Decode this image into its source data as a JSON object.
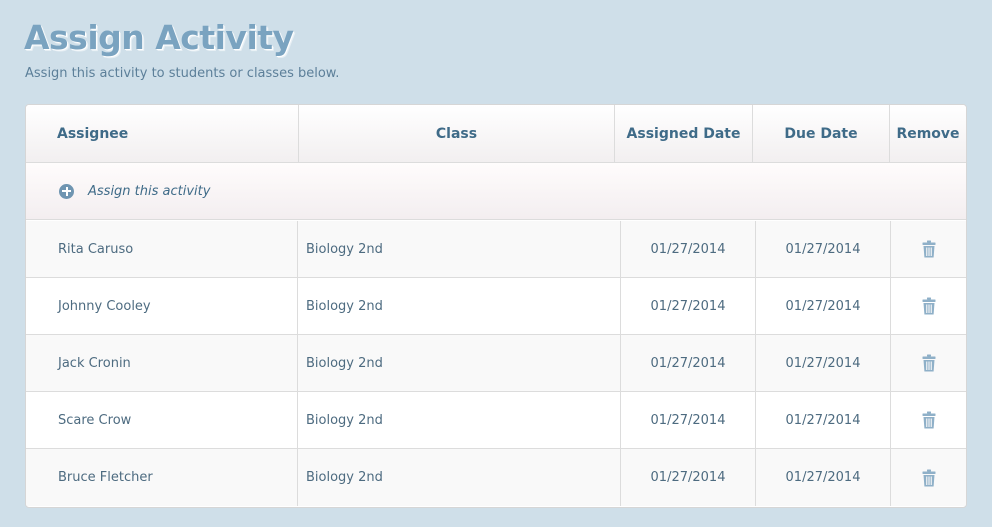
{
  "page": {
    "title": "Assign Activity",
    "subtitle": "Assign this activity to students or classes below."
  },
  "table": {
    "headers": {
      "assignee": "Assignee",
      "class": "Class",
      "assigned_date": "Assigned Date",
      "due_date": "Due Date",
      "remove": "Remove"
    },
    "assign_action": {
      "label": "Assign this activity",
      "icon": "plus-circle-icon"
    },
    "remove_icon": "trash-icon",
    "rows": [
      {
        "assignee": "Rita Caruso",
        "class": "Biology 2nd",
        "assigned_date": "01/27/2014",
        "due_date": "01/27/2014"
      },
      {
        "assignee": "Johnny Cooley",
        "class": "Biology 2nd",
        "assigned_date": "01/27/2014",
        "due_date": "01/27/2014"
      },
      {
        "assignee": "Jack Cronin",
        "class": "Biology 2nd",
        "assigned_date": "01/27/2014",
        "due_date": "01/27/2014"
      },
      {
        "assignee": "Scare Crow",
        "class": "Biology 2nd",
        "assigned_date": "01/27/2014",
        "due_date": "01/27/2014"
      },
      {
        "assignee": "Bruce Fletcher",
        "class": "Biology 2nd",
        "assigned_date": "01/27/2014",
        "due_date": "01/27/2014"
      }
    ]
  },
  "colors": {
    "background": "#cfdfe9",
    "title": "#7aa3c0",
    "header_text": "#3f6b88",
    "body_text": "#4d6b80",
    "icon": "#6f95b1"
  }
}
